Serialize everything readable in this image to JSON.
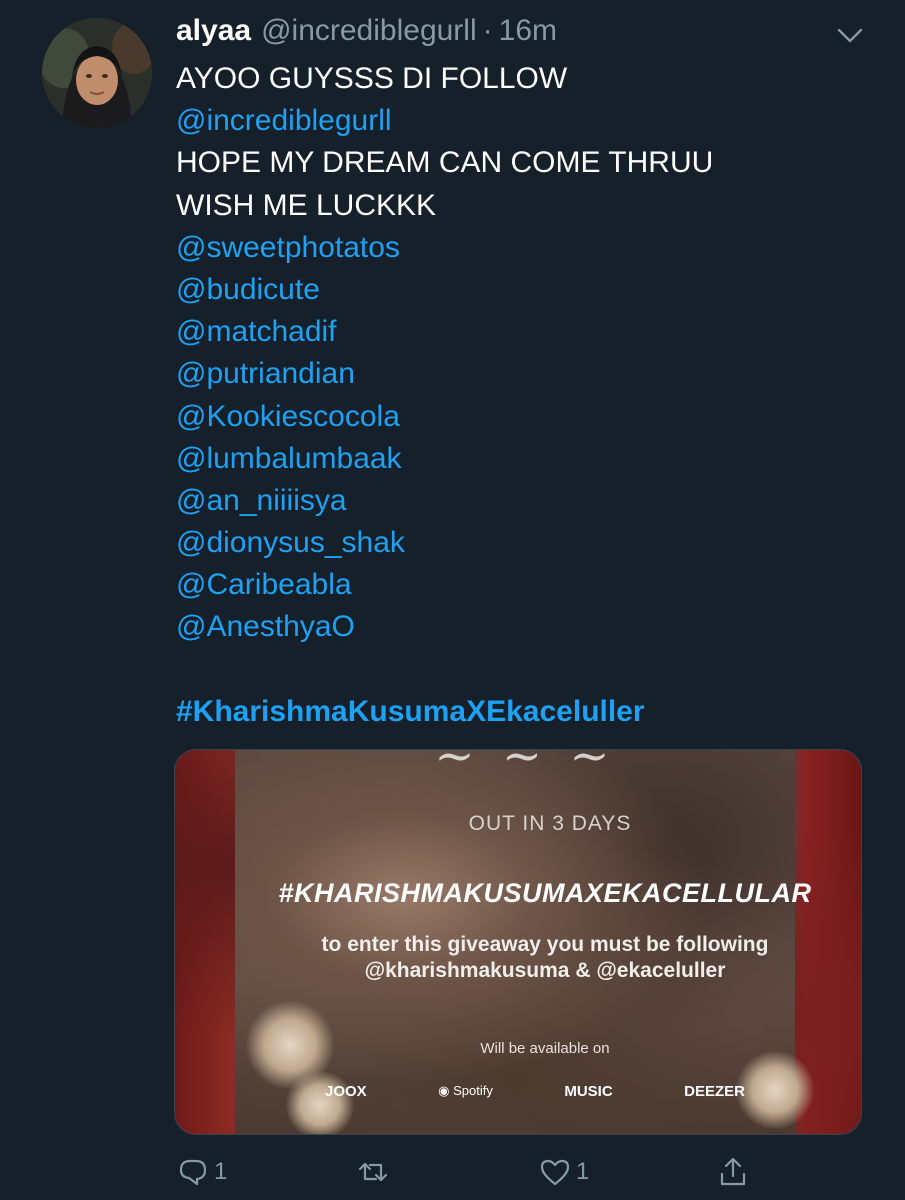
{
  "tweet": {
    "author_name": "alyaa",
    "author_handle": "@incrediblegurll",
    "separator": "·",
    "time_ago": "16m",
    "lines": [
      {
        "text": "AYOO GUYSSS DI FOLLOW",
        "kind": "text"
      },
      {
        "text": "@incrediblegurll",
        "kind": "mention"
      },
      {
        "text": "HOPE MY DREAM CAN COME THRUU",
        "kind": "text"
      },
      {
        "text": "WISH ME LUCKKK",
        "kind": "text"
      },
      {
        "text": "@sweetphotatos",
        "kind": "mention"
      },
      {
        "text": "@budicute",
        "kind": "mention"
      },
      {
        "text": "@matchadif",
        "kind": "mention"
      },
      {
        "text": "@putriandian",
        "kind": "mention"
      },
      {
        "text": "@Kookiescocola",
        "kind": "mention"
      },
      {
        "text": "@lumbalumbaak",
        "kind": "mention"
      },
      {
        "text": "@an_niiiisya",
        "kind": "mention"
      },
      {
        "text": "@dionysus_shak",
        "kind": "mention"
      },
      {
        "text": "@Caribeabla",
        "kind": "mention"
      },
      {
        "text": "@AnesthyaO",
        "kind": "mention"
      },
      {
        "text": "",
        "kind": "blank"
      },
      {
        "text": "#KharishmaKusumaXEkaceluller",
        "kind": "hashtag"
      }
    ]
  },
  "media": {
    "script_title": "~ ~ ~",
    "out_text": "OUT IN 3 DAYS",
    "hashtag": "#KHARISHMAKUSUMAXEKACELLULAR",
    "enter_line1": "to enter this giveaway you must be following",
    "enter_line2": "@kharishmakusuma & @ekaceluller",
    "available": "Will be available on",
    "platforms": [
      "JOOX",
      "Spotify",
      "MUSIC",
      "DEEZER"
    ]
  },
  "actions": {
    "reply_count": "1",
    "like_count": "1"
  },
  "colors": {
    "background": "#15202b",
    "link": "#1da1f2",
    "muted": "#8899a6"
  }
}
